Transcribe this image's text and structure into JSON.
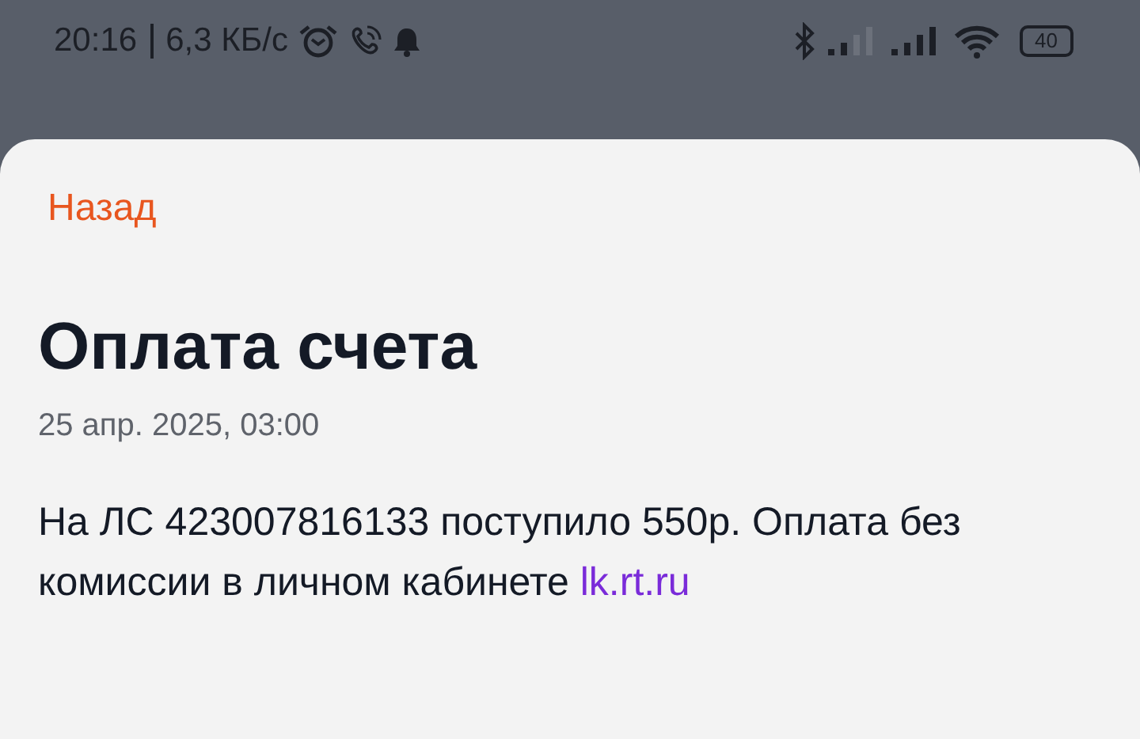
{
  "status_bar": {
    "time": "20:16",
    "speed": "6,3 КБ/с",
    "battery": "40"
  },
  "sheet": {
    "back": "Назад",
    "title": "Оплата счета",
    "date": "25 апр. 2025, 03:00",
    "body": "На ЛС 423007816133 поступило 550р. Оплата без комиссии в личном кабинете",
    "link": "lk.rt.ru"
  }
}
